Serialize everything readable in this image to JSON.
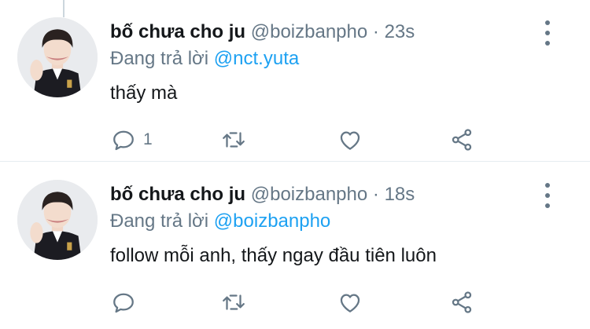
{
  "colors": {
    "text": "#14171a",
    "secondary": "#657786",
    "accent": "#1da1f2",
    "divider": "#e6ecf0"
  },
  "tweets": [
    {
      "name": "bố chưa cho ju",
      "handle": "@boizbanpho",
      "separator": "·",
      "time": "23s",
      "reply_prefix": "Đang trả lời",
      "reply_to": "@nct.yuta",
      "text": "thấy mà",
      "reply_count": "1",
      "icons": [
        "reply-icon",
        "retweet-icon",
        "like-icon",
        "share-icon",
        "more-icon"
      ]
    },
    {
      "name": "bố chưa cho ju",
      "handle": "@boizbanpho",
      "separator": "·",
      "time": "18s",
      "reply_prefix": "Đang trả lời",
      "reply_to": "@boizbanpho",
      "text": "follow mỗi anh, thấy ngay đầu tiên luôn",
      "reply_count": "",
      "icons": [
        "reply-icon",
        "retweet-icon",
        "like-icon",
        "share-icon",
        "more-icon"
      ]
    }
  ]
}
